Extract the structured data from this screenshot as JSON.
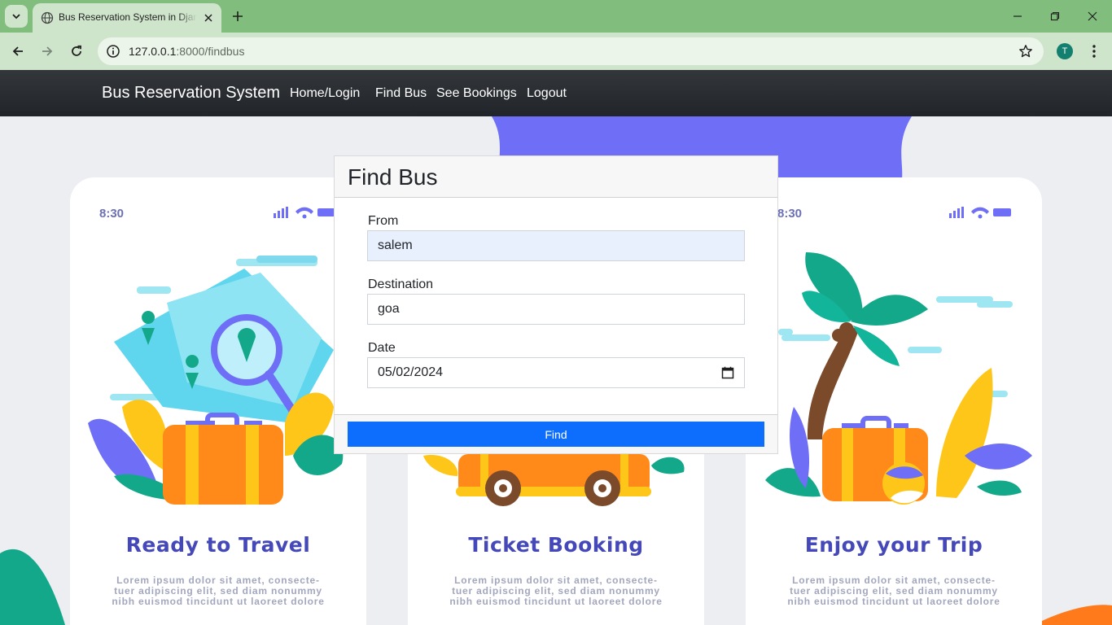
{
  "browser": {
    "tab_title": "Bus Reservation System in Django",
    "url_host": "127.0.0.1",
    "url_path": ":8000/findbus",
    "profile_initial": "T"
  },
  "navbar": {
    "brand": "Bus Reservation System",
    "links": [
      "Home/Login",
      "Find Bus",
      "See Bookings",
      "Logout"
    ]
  },
  "form": {
    "title": "Find Bus",
    "from_label": "From",
    "from_value": "salem",
    "destination_label": "Destination",
    "destination_value": "goa",
    "date_label": "Date",
    "date_value": "05/02/2024",
    "submit_label": "Find"
  },
  "background": {
    "phone_time": "8:30",
    "cards": [
      {
        "heading": "Ready to Travel",
        "body": [
          "Lorem ipsum dolor sit amet, consecte-",
          "tuer adipiscing elit, sed diam nonummy",
          "nibh euismod tincidunt ut laoreet dolore"
        ]
      },
      {
        "heading": "Ticket Booking",
        "body": [
          "Lorem ipsum dolor sit amet, consecte-",
          "tuer adipiscing elit, sed diam nonummy",
          "nibh euismod tincidunt ut laoreet dolore"
        ]
      },
      {
        "heading": "Enjoy your Trip",
        "body": [
          "Lorem ipsum dolor sit amet, consecte-",
          "tuer adipiscing elit, sed diam nonummy",
          "nibh euismod tincidunt ut laoreet dolore"
        ]
      }
    ]
  },
  "colors": {
    "chrome_green": "#81bd7c",
    "navbar_dark": "#212529",
    "primary_button": "#0d6efd",
    "illustration_purple": "#6e6ef7",
    "heading_indigo": "#4548b8"
  }
}
